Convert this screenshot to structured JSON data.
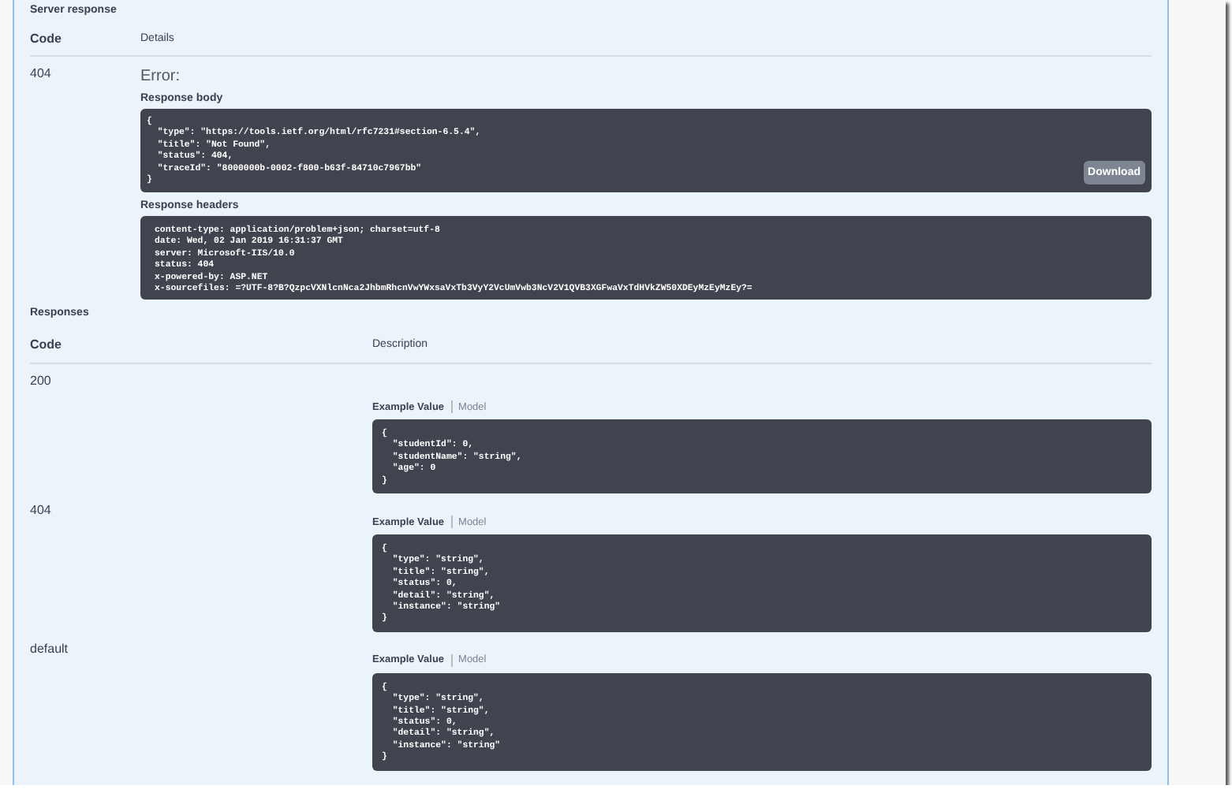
{
  "server_response": {
    "title": "Server response",
    "columns": [
      "Code",
      "Details"
    ],
    "row": {
      "code": "404",
      "error_label": "Error:",
      "body_label": "Response body",
      "body": "{\n  \"type\": \"https://tools.ietf.org/html/rfc7231#section-6.5.4\",\n  \"title\": \"Not Found\",\n  \"status\": 404,\n  \"traceId\": \"8000000b-0002-f800-b63f-84710c7967bb\"\n}",
      "download": "Download",
      "headers_label": "Response headers",
      "headers": "content-type: application/problem+json; charset=utf-8\ndate: Wed, 02 Jan 2019 16:31:37 GMT\nserver: Microsoft-IIS/10.0\nstatus: 404\nx-powered-by: ASP.NET\nx-sourcefiles: =?UTF-8?B?QzpcVXNlcnNca2JhbmRhcnVwYWxsaVxTb3VyY2VcUmVwb3NcV2V1QVB3XGFwaVxTdHVkZW50XDEyMzEyMzEy?="
    }
  },
  "responses": {
    "title": "Responses",
    "columns": [
      "Code",
      "Description"
    ],
    "rows": [
      {
        "code": "200",
        "tabs": [
          {
            "label": "Example Value",
            "selected": true
          },
          {
            "label": "Model",
            "selected": false
          }
        ],
        "example": "{\n  \"studentId\": 0,\n  \"studentName\": \"string\",\n  \"age\": 0\n}"
      },
      {
        "code": "404",
        "tabs": [
          {
            "label": "Example Value",
            "selected": true
          },
          {
            "label": "Model",
            "selected": false
          }
        ],
        "example": "{\n  \"type\": \"string\",\n  \"title\": \"string\",\n  \"status\": 0,\n  \"detail\": \"string\",\n  \"instance\": \"string\"\n}"
      },
      {
        "code": "default",
        "tabs": [
          {
            "label": "Example Value",
            "selected": true
          },
          {
            "label": "Model",
            "selected": false
          }
        ],
        "example": "{\n  \"type\": \"string\",\n  \"title\": \"string\",\n  \"status\": 0,\n  \"detail\": \"string\",\n  \"instance\": \"string\"\n}"
      }
    ]
  }
}
